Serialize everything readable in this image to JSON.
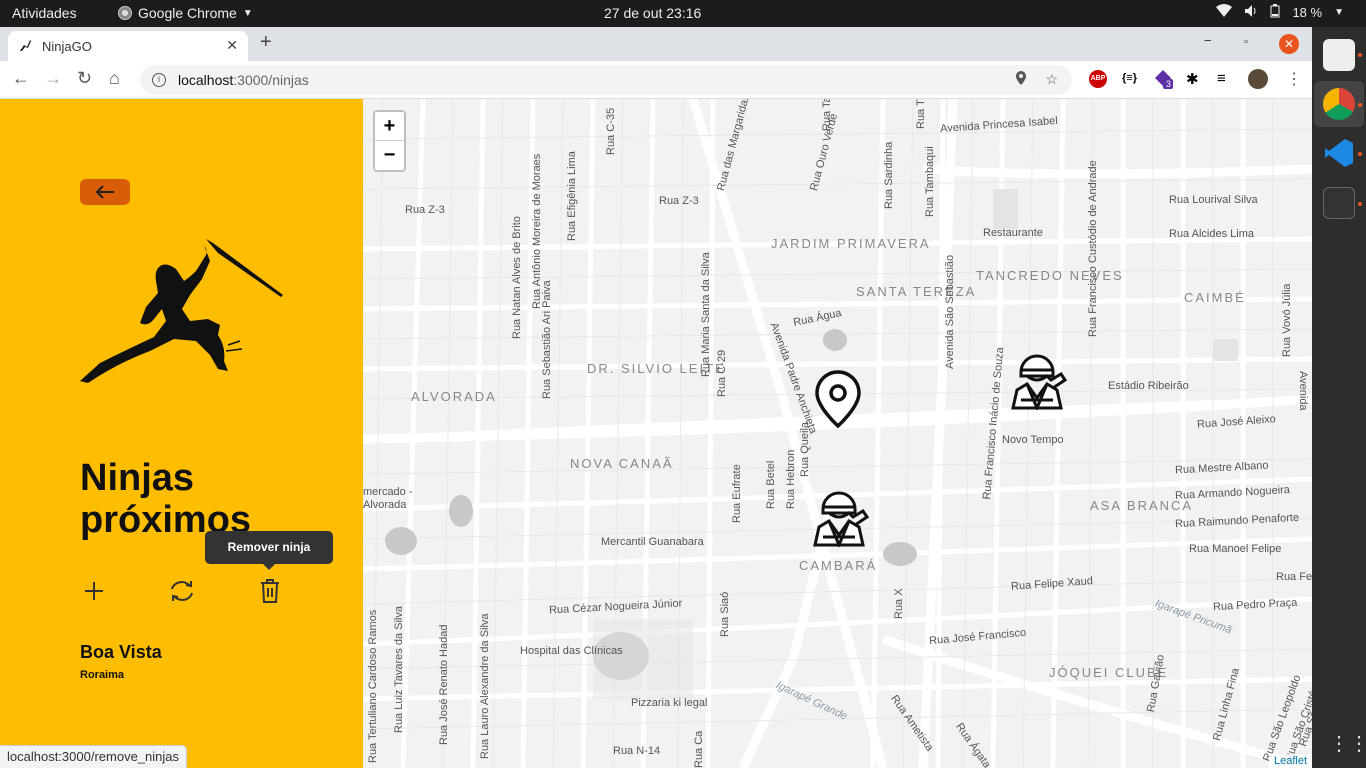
{
  "os_bar": {
    "activities": "Atividades",
    "app_name": "Google Chrome",
    "clock": "27 de out  23:16",
    "battery": "18 %"
  },
  "browser": {
    "tab_title": "NinjaGO",
    "url_host": "localhost",
    "url_path": ":3000/ninjas",
    "extension_badge": "3",
    "status_url": "localhost:3000/remove_ninjas"
  },
  "sidebar": {
    "title": "Ninjas próximos",
    "tooltip": "Remover ninja",
    "city": "Boa Vista",
    "state": "Roraima",
    "actions": [
      "add-ninja",
      "refresh-ninjas",
      "remove-ninja"
    ]
  },
  "map": {
    "zoom_in": "+",
    "zoom_out": "−",
    "attribution": "Leaflet",
    "districts": [
      "JARDIM PRIMAVERA",
      "SANTA TEREZA",
      "TANCREDO NEVES",
      "CAIMBÉ",
      "DR. SILVIO LEITE",
      "ALVORADA",
      "NOVA CANAÃ",
      "ASA BRANCA",
      "CAMBARÁ",
      "JÓQUEI CLUBE"
    ],
    "places": [
      "Restaurante",
      "Estádio Ribeirão",
      "Novo Tempo",
      "Mercantil Guanabara",
      "Hospital das Clínicas",
      "Pizzaria ki legal",
      "mercado - Alvorada"
    ],
    "streets_h": [
      "Avenida Princesa Isabel",
      "Rua Lourival Silva",
      "Rua Alcides Lima",
      "Rua Z-3",
      "Rua Z-3",
      "Rua Água",
      "Rua José Aleixo",
      "Rua Mestre Albano",
      "Rua Armando Nogueira",
      "Rua Raimundo Penaforte",
      "Rua Manoel Felipe",
      "Rua Felipe Xaud",
      "Rua Felip",
      "Rua Pedro Praça",
      "Rua José Francisco",
      "Rua Cézar Nogueira Júnior",
      "Rua N-14",
      "Igarapé Pricumã",
      "Igarapé Grande"
    ],
    "streets_v": [
      "Rua Natan Alves de Brito",
      "Rua Antônio Moreira de Moraes",
      "Rua Sebastião Ari Paiva",
      "Rua Efigênia Lima",
      "Rua C-35",
      "Rua Maria Santa da Silva",
      "Rua C-29",
      "Rua das Margaridas",
      "Rua Ouro Verde",
      "Rua Sardinha",
      "Rua Tambaqui",
      "Avenida São Sebastião",
      "Rua Francisco Custódio de Andrade",
      "Rua Vovó Júlia",
      "Rua Francisco Inácio de Souza",
      "Rua Queila",
      "Rua Hebron",
      "Rua Betel",
      "Rua Eufrate",
      "Rua Siaó",
      "Rua X",
      "Rua Tertuliano Cardoso Ramos",
      "Rua Luiz Tavares da Silva",
      "Rua José Renato Hadad",
      "Rua Lauro Alexandre da Silva",
      "Rua Ca",
      "Rua Ametista",
      "Rua Ágata",
      "Rua Gavião",
      "Rua Linha Fina",
      "Rua São Leopoldo",
      "Rua São Cristóvão",
      "Rua São José",
      "Avenida Padre Anchieta",
      "Rua Tra",
      "Rua Ta",
      "Avenida"
    ]
  },
  "colors": {
    "sidebar_bg": "#ffbd00",
    "back_button": "#d95d06",
    "map_bg": "#f2f2f2"
  }
}
